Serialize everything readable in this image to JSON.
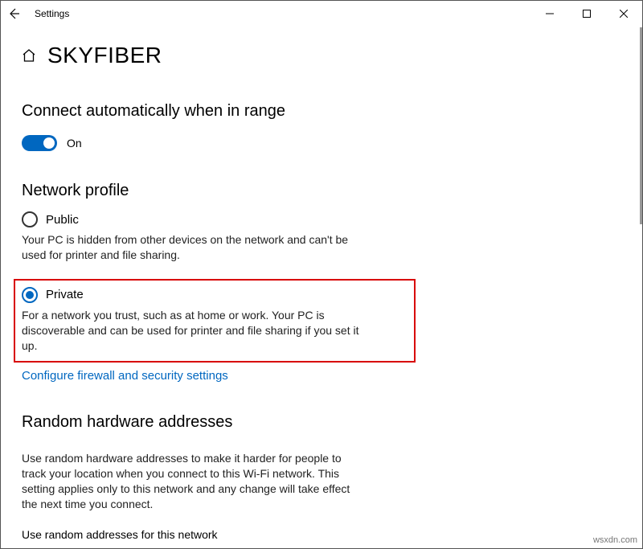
{
  "titlebar": {
    "title": "Settings"
  },
  "page": {
    "network_name": "SKYFIBER"
  },
  "auto_connect": {
    "heading": "Connect automatically when in range",
    "state_label": "On"
  },
  "network_profile": {
    "heading": "Network profile",
    "public": {
      "label": "Public",
      "desc": "Your PC is hidden from other devices on the network and can't be used for printer and file sharing."
    },
    "private": {
      "label": "Private",
      "desc": "For a network you trust, such as at home or work. Your PC is discoverable and can be used for printer and file sharing if you set it up."
    },
    "link": "Configure firewall and security settings"
  },
  "random_hw": {
    "heading": "Random hardware addresses",
    "desc": "Use random hardware addresses to make it harder for people to track your location when you connect to this Wi-Fi network. This setting applies only to this network and any change will take effect the next time you connect.",
    "sub_label": "Use random addresses for this network"
  },
  "watermark": "wsxdn.com"
}
